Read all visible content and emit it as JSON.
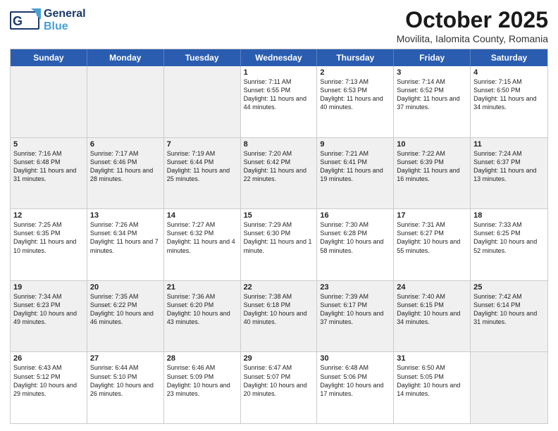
{
  "header": {
    "logo_general": "General",
    "logo_blue": "Blue",
    "title": "October 2025",
    "subtitle": "Movilita, Ialomita County, Romania"
  },
  "days_of_week": [
    "Sunday",
    "Monday",
    "Tuesday",
    "Wednesday",
    "Thursday",
    "Friday",
    "Saturday"
  ],
  "weeks": [
    [
      {
        "day": "",
        "sunrise": "",
        "sunset": "",
        "daylight": "",
        "empty": true
      },
      {
        "day": "",
        "sunrise": "",
        "sunset": "",
        "daylight": "",
        "empty": true
      },
      {
        "day": "",
        "sunrise": "",
        "sunset": "",
        "daylight": "",
        "empty": true
      },
      {
        "day": "1",
        "sunrise": "Sunrise: 7:11 AM",
        "sunset": "Sunset: 6:55 PM",
        "daylight": "Daylight: 11 hours and 44 minutes."
      },
      {
        "day": "2",
        "sunrise": "Sunrise: 7:13 AM",
        "sunset": "Sunset: 6:53 PM",
        "daylight": "Daylight: 11 hours and 40 minutes."
      },
      {
        "day": "3",
        "sunrise": "Sunrise: 7:14 AM",
        "sunset": "Sunset: 6:52 PM",
        "daylight": "Daylight: 11 hours and 37 minutes."
      },
      {
        "day": "4",
        "sunrise": "Sunrise: 7:15 AM",
        "sunset": "Sunset: 6:50 PM",
        "daylight": "Daylight: 11 hours and 34 minutes."
      }
    ],
    [
      {
        "day": "5",
        "sunrise": "Sunrise: 7:16 AM",
        "sunset": "Sunset: 6:48 PM",
        "daylight": "Daylight: 11 hours and 31 minutes."
      },
      {
        "day": "6",
        "sunrise": "Sunrise: 7:17 AM",
        "sunset": "Sunset: 6:46 PM",
        "daylight": "Daylight: 11 hours and 28 minutes."
      },
      {
        "day": "7",
        "sunrise": "Sunrise: 7:19 AM",
        "sunset": "Sunset: 6:44 PM",
        "daylight": "Daylight: 11 hours and 25 minutes."
      },
      {
        "day": "8",
        "sunrise": "Sunrise: 7:20 AM",
        "sunset": "Sunset: 6:42 PM",
        "daylight": "Daylight: 11 hours and 22 minutes."
      },
      {
        "day": "9",
        "sunrise": "Sunrise: 7:21 AM",
        "sunset": "Sunset: 6:41 PM",
        "daylight": "Daylight: 11 hours and 19 minutes."
      },
      {
        "day": "10",
        "sunrise": "Sunrise: 7:22 AM",
        "sunset": "Sunset: 6:39 PM",
        "daylight": "Daylight: 11 hours and 16 minutes."
      },
      {
        "day": "11",
        "sunrise": "Sunrise: 7:24 AM",
        "sunset": "Sunset: 6:37 PM",
        "daylight": "Daylight: 11 hours and 13 minutes."
      }
    ],
    [
      {
        "day": "12",
        "sunrise": "Sunrise: 7:25 AM",
        "sunset": "Sunset: 6:35 PM",
        "daylight": "Daylight: 11 hours and 10 minutes."
      },
      {
        "day": "13",
        "sunrise": "Sunrise: 7:26 AM",
        "sunset": "Sunset: 6:34 PM",
        "daylight": "Daylight: 11 hours and 7 minutes."
      },
      {
        "day": "14",
        "sunrise": "Sunrise: 7:27 AM",
        "sunset": "Sunset: 6:32 PM",
        "daylight": "Daylight: 11 hours and 4 minutes."
      },
      {
        "day": "15",
        "sunrise": "Sunrise: 7:29 AM",
        "sunset": "Sunset: 6:30 PM",
        "daylight": "Daylight: 11 hours and 1 minute."
      },
      {
        "day": "16",
        "sunrise": "Sunrise: 7:30 AM",
        "sunset": "Sunset: 6:28 PM",
        "daylight": "Daylight: 10 hours and 58 minutes."
      },
      {
        "day": "17",
        "sunrise": "Sunrise: 7:31 AM",
        "sunset": "Sunset: 6:27 PM",
        "daylight": "Daylight: 10 hours and 55 minutes."
      },
      {
        "day": "18",
        "sunrise": "Sunrise: 7:33 AM",
        "sunset": "Sunset: 6:25 PM",
        "daylight": "Daylight: 10 hours and 52 minutes."
      }
    ],
    [
      {
        "day": "19",
        "sunrise": "Sunrise: 7:34 AM",
        "sunset": "Sunset: 6:23 PM",
        "daylight": "Daylight: 10 hours and 49 minutes."
      },
      {
        "day": "20",
        "sunrise": "Sunrise: 7:35 AM",
        "sunset": "Sunset: 6:22 PM",
        "daylight": "Daylight: 10 hours and 46 minutes."
      },
      {
        "day": "21",
        "sunrise": "Sunrise: 7:36 AM",
        "sunset": "Sunset: 6:20 PM",
        "daylight": "Daylight: 10 hours and 43 minutes."
      },
      {
        "day": "22",
        "sunrise": "Sunrise: 7:38 AM",
        "sunset": "Sunset: 6:18 PM",
        "daylight": "Daylight: 10 hours and 40 minutes."
      },
      {
        "day": "23",
        "sunrise": "Sunrise: 7:39 AM",
        "sunset": "Sunset: 6:17 PM",
        "daylight": "Daylight: 10 hours and 37 minutes."
      },
      {
        "day": "24",
        "sunrise": "Sunrise: 7:40 AM",
        "sunset": "Sunset: 6:15 PM",
        "daylight": "Daylight: 10 hours and 34 minutes."
      },
      {
        "day": "25",
        "sunrise": "Sunrise: 7:42 AM",
        "sunset": "Sunset: 6:14 PM",
        "daylight": "Daylight: 10 hours and 31 minutes."
      }
    ],
    [
      {
        "day": "26",
        "sunrise": "Sunrise: 6:43 AM",
        "sunset": "Sunset: 5:12 PM",
        "daylight": "Daylight: 10 hours and 29 minutes."
      },
      {
        "day": "27",
        "sunrise": "Sunrise: 6:44 AM",
        "sunset": "Sunset: 5:10 PM",
        "daylight": "Daylight: 10 hours and 26 minutes."
      },
      {
        "day": "28",
        "sunrise": "Sunrise: 6:46 AM",
        "sunset": "Sunset: 5:09 PM",
        "daylight": "Daylight: 10 hours and 23 minutes."
      },
      {
        "day": "29",
        "sunrise": "Sunrise: 6:47 AM",
        "sunset": "Sunset: 5:07 PM",
        "daylight": "Daylight: 10 hours and 20 minutes."
      },
      {
        "day": "30",
        "sunrise": "Sunrise: 6:48 AM",
        "sunset": "Sunset: 5:06 PM",
        "daylight": "Daylight: 10 hours and 17 minutes."
      },
      {
        "day": "31",
        "sunrise": "Sunrise: 6:50 AM",
        "sunset": "Sunset: 5:05 PM",
        "daylight": "Daylight: 10 hours and 14 minutes."
      },
      {
        "day": "",
        "sunrise": "",
        "sunset": "",
        "daylight": "",
        "empty": true
      }
    ]
  ]
}
